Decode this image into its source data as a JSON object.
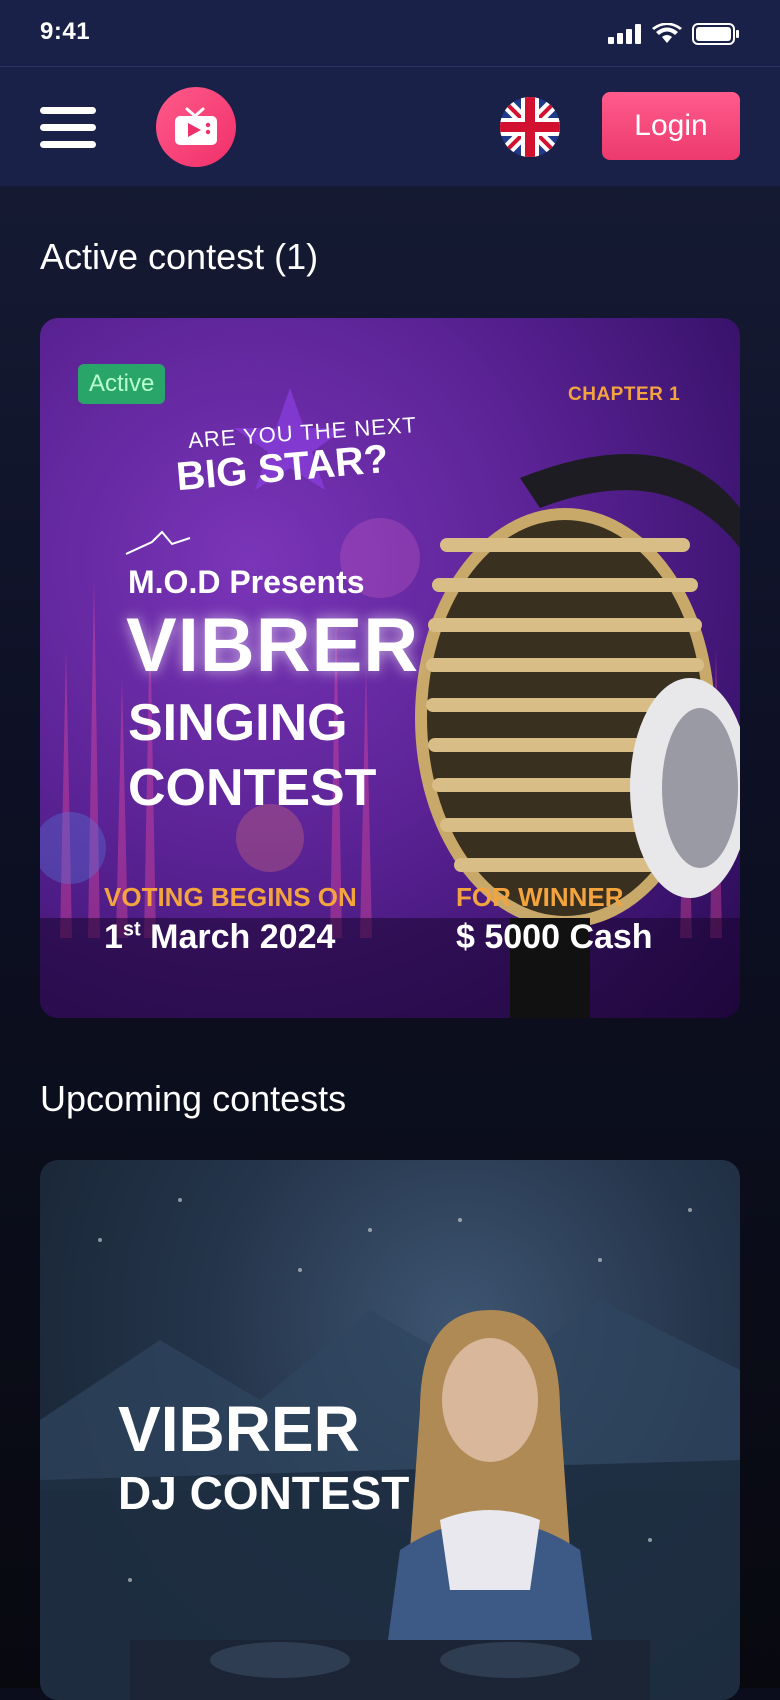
{
  "status_bar": {
    "time": "9:41"
  },
  "header": {
    "login_label": "Login"
  },
  "active_section": {
    "title": "Active contest (1)",
    "card": {
      "badge": "Active",
      "chapter": "CHAPTER 1",
      "tagline_small": "ARE YOU THE NEXT",
      "tagline_big": "BIG STAR?",
      "presents": "M.O.D Presents",
      "title_line1": "VIBRER",
      "title_line2": "SINGING",
      "title_line3": "CONTEST",
      "voting_label": "VOTING BEGINS ON",
      "voting_day": "1",
      "voting_suffix": "st",
      "voting_rest": " March 2024",
      "winner_label": "FOR WINNER",
      "winner_value": "$ 5000 Cash"
    }
  },
  "upcoming_section": {
    "title": "Upcoming contests",
    "card": {
      "title_line1": "VIBRER",
      "title_line2": "DJ CONTEST"
    }
  },
  "colors": {
    "accent": "#f0306a",
    "badge": "#2aa56a",
    "highlight": "#f3a43f"
  },
  "icons": [
    "signal-icon",
    "wifi-icon",
    "battery-icon",
    "menu-icon",
    "tv-logo-icon",
    "uk-flag-icon"
  ]
}
